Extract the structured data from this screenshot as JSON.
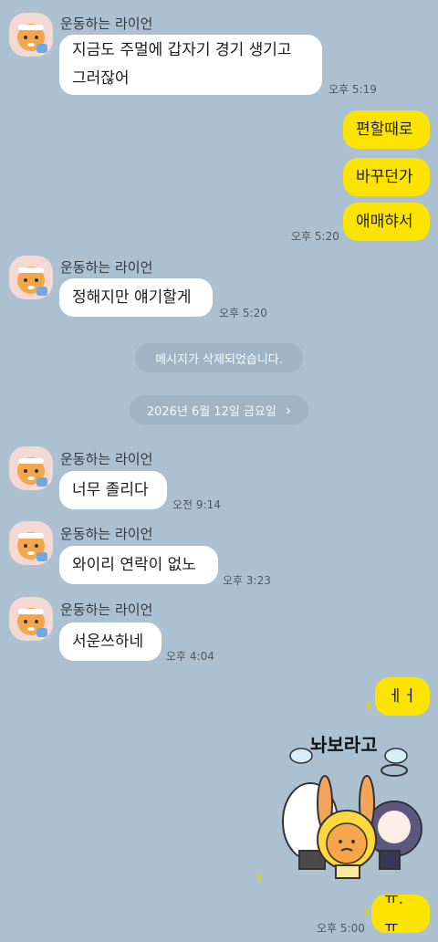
{
  "sender_name": "운동하는 라이언",
  "messages": {
    "m1": {
      "text": "지금도 주멀에 갑자기 경기 생기고 그러잖어",
      "time": "오후 5:19"
    },
    "y1": {
      "text": "편할때로"
    },
    "y2": {
      "text": "바꾸던가"
    },
    "y3": {
      "text": "애매햐서",
      "time": "오후 5:20"
    },
    "m2": {
      "text": "정해지만 얘기할게",
      "time": "오후 5:20"
    },
    "deleted": "메시지가 삭제되었습니다.",
    "date_divider": "2026년 6월 12일 금요일",
    "date_chevron": "›",
    "m3": {
      "text": "너무 졸리다",
      "time": "오전 9:14"
    },
    "m4": {
      "text": "와이리 연락이 없노",
      "time": "오후 3:23"
    },
    "m5": {
      "text": "서운쓰하네",
      "time": "오후 4:04"
    },
    "y4": {
      "text": "ㅔㅓ",
      "unread": "1"
    },
    "sticker": {
      "caption": "놔보라고",
      "unread": "1"
    },
    "y5": {
      "text": "ㅠ.ㅠ",
      "unread": "1",
      "time": "오후 5:00"
    }
  },
  "colors": {
    "background": "#abc1d1",
    "mine": "#fce300",
    "theirs": "#ffffff",
    "unread": "#e4d500"
  }
}
